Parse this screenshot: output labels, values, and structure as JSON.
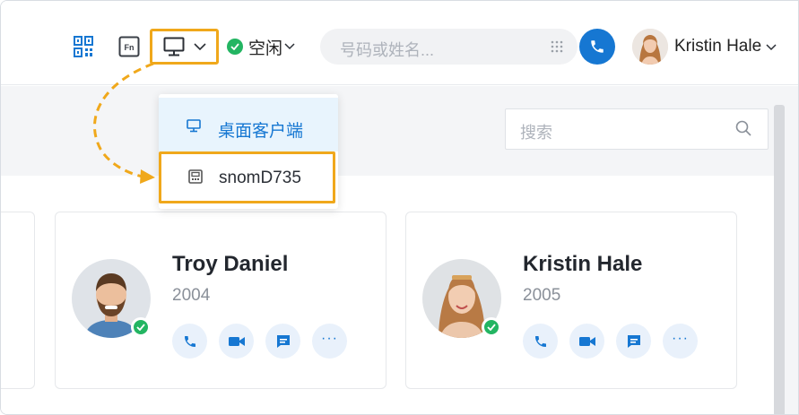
{
  "header": {
    "qr_icon": "qr-code-icon",
    "fn_label": "Fn",
    "device_icon": "desktop-monitor-icon",
    "status": {
      "label": "空闲",
      "color": "#23b562"
    },
    "dial_search": {
      "placeholder": "号码或姓名..."
    },
    "user": {
      "name": "Kristin Hale"
    }
  },
  "device_menu": {
    "items": [
      {
        "label": "桌面客户端",
        "icon": "desktop-monitor-icon",
        "selected": true
      },
      {
        "label": "snomD735",
        "icon": "desk-phone-icon",
        "selected": false,
        "highlighted": true
      }
    ]
  },
  "contacts": {
    "search_placeholder": "搜索",
    "cards": [
      {
        "name": "Troy Daniel",
        "ext": "2004",
        "online": true
      },
      {
        "name": "Kristin Hale",
        "ext": "2005",
        "online": true
      }
    ]
  },
  "colors": {
    "accent": "#1677d2",
    "highlight": "#f0a81b",
    "online": "#23b562"
  }
}
